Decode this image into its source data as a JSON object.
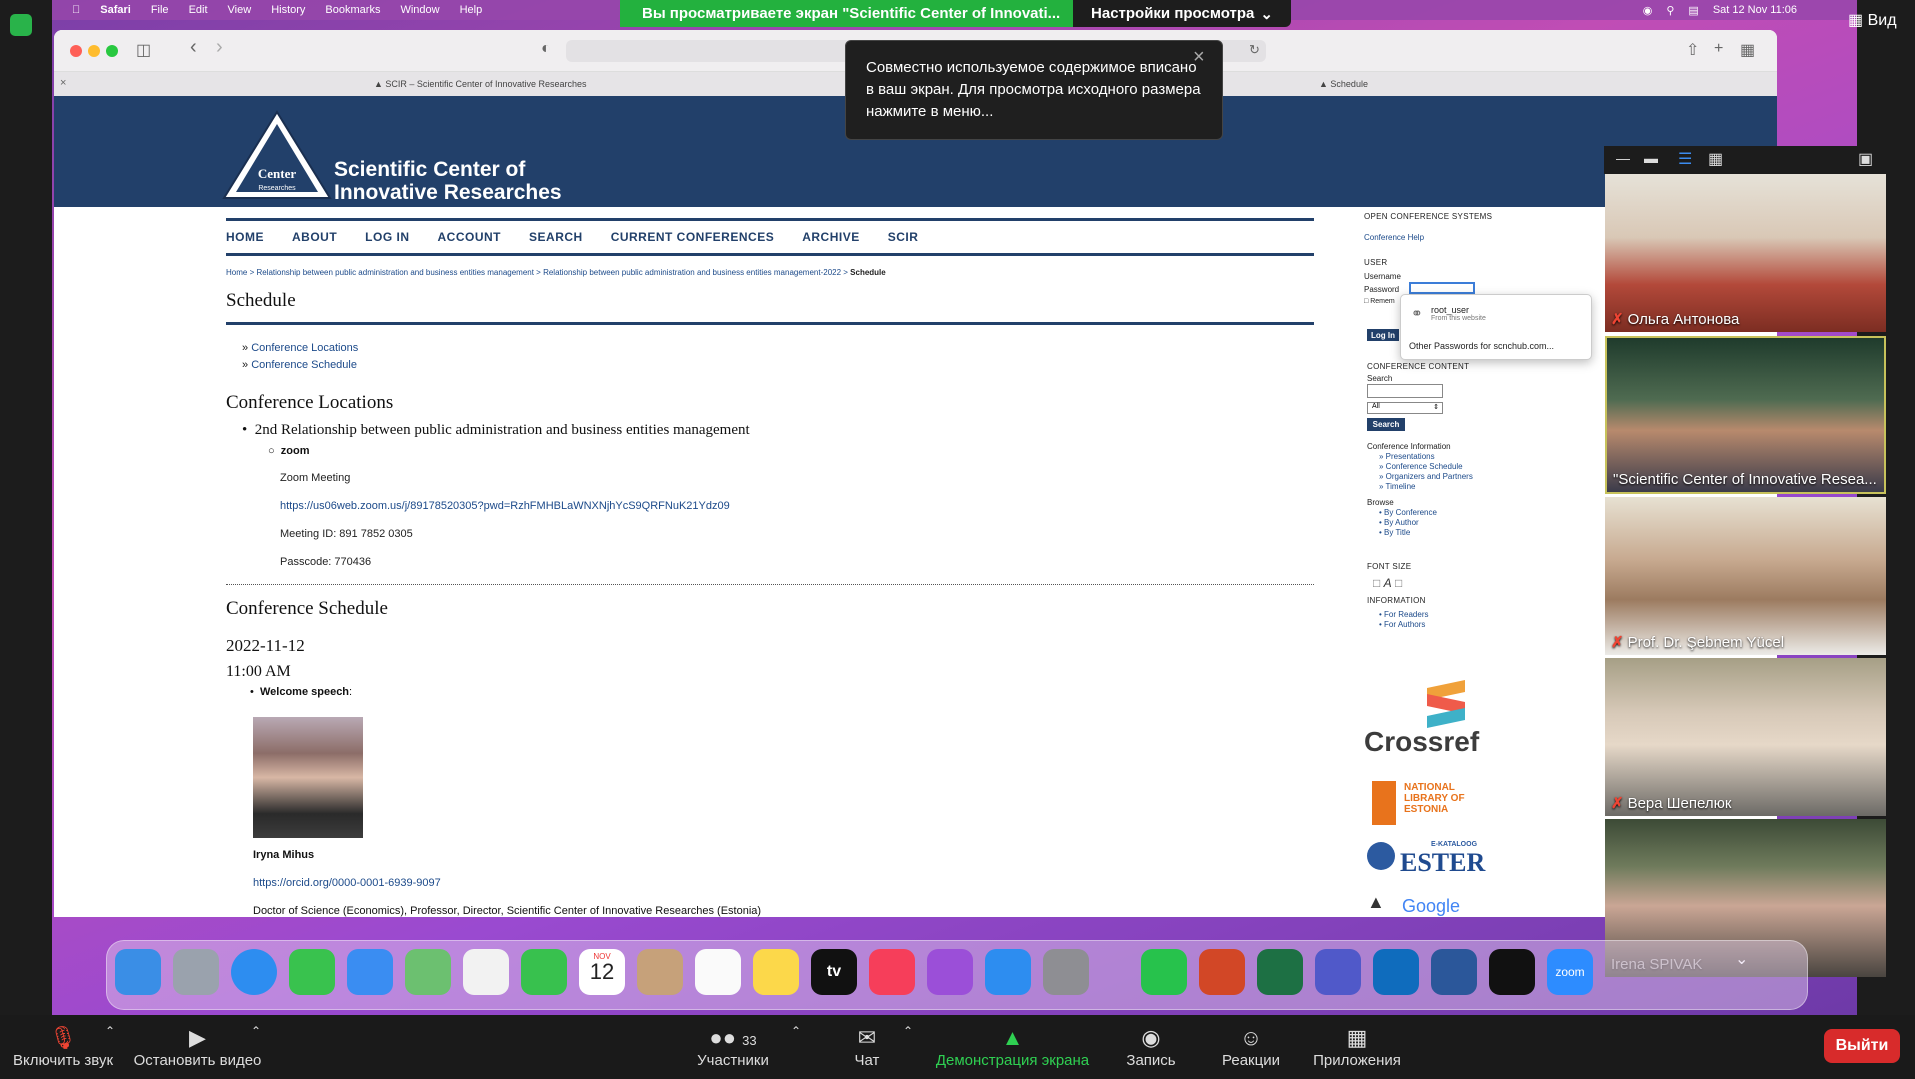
{
  "menubar": {
    "items": [
      "Safari",
      "File",
      "Edit",
      "View",
      "History",
      "Bookmarks",
      "Window",
      "Help"
    ],
    "datetime": "Sat 12 Nov  11:06"
  },
  "zoom_banner": {
    "sharing_text": "Вы просматриваете экран \"Scientific Center of Innovati...",
    "view_settings": "Настройки просмотра",
    "view_button": "Вид"
  },
  "safari": {
    "tab1": "SCIR – Scientific Center of Innovative Researches",
    "tab2": "Schedule"
  },
  "notification": {
    "text": "Совместно используемое содержимое вписано в ваш экран. Для просмотра исходного размера нажмите в меню..."
  },
  "site": {
    "logo_text": "Scientific Innovative Center Researches",
    "title_line1": "Scientific Center of",
    "title_line2": "Innovative Researches",
    "nav": [
      "HOME",
      "ABOUT",
      "LOG IN",
      "ACCOUNT",
      "SEARCH",
      "CURRENT CONFERENCES",
      "ARCHIVE",
      "SCIR"
    ],
    "breadcrumb": "Home > Relationship between public administration and business entities management > Relationship between public administration and business entities management-2022 > ",
    "breadcrumb_current": "Schedule",
    "heading": "Schedule",
    "toc": [
      "Conference Locations",
      "Conference Schedule"
    ],
    "loc_heading": "Conference Locations",
    "loc_item": "2nd Relationship between public administration and business entities management",
    "loc_sub": "zoom",
    "zoom_meeting": "Zoom Meeting",
    "zoom_link": "https://us06web.zoom.us/j/89178520305?pwd=RzhFMHBLaWNXNjhYcS9QRFNuK21Ydz09",
    "meeting_id": "Meeting ID: 891 7852 0305",
    "passcode": "Passcode: 770436",
    "sched_heading": "Conference Schedule",
    "date": "2022-11-12",
    "time": "11:00 AM",
    "welcome": "Welcome speech",
    "speaker": "Iryna Mihus",
    "orcid": "https://orcid.org/0000-0001-6939-9097",
    "bio": "Doctor of Science (Economics), Professor, Director, Scientific Center of Innovative Researches (Estonia)"
  },
  "sidebar": {
    "ocs": "OPEN CONFERENCE SYSTEMS",
    "help": "Conference Help",
    "user": "USER",
    "username": "Username",
    "password": "Password",
    "remember": "Remem",
    "login": "Log In",
    "content": "CONFERENCE CONTENT",
    "search_label": "Search",
    "search_option": "All",
    "search_btn": "Search",
    "conf_info": "Conference Information",
    "conf_links": [
      "Presentations",
      "Conference Schedule",
      "Organizers and Partners",
      "Timeline"
    ],
    "browse": "Browse",
    "browse_links": [
      "By Conference",
      "By Author",
      "By Title"
    ],
    "font_size": "FONT SIZE",
    "information": "INFORMATION",
    "info_links": [
      "For Readers",
      "For Authors"
    ],
    "pw_user": "root_user",
    "pw_from": "From this website",
    "pw_other": "Other Passwords for scnchub.com...",
    "crossref": "Crossref",
    "nle": "NATIONAL LIBRARY OF ESTONIA",
    "ester_small": "E-KATALOOG",
    "ester": "ESTER",
    "google": "Google"
  },
  "participants": [
    {
      "name": "Ольга Антонова",
      "muted": true
    },
    {
      "name": "\"Scientific Center of Innovative Resea...",
      "muted": false
    },
    {
      "name": "Prof. Dr. Şebnem Yücel",
      "muted": true
    },
    {
      "name": "Вера Шепелюк",
      "muted": true
    },
    {
      "name": "Irena SPIVAK",
      "muted": false
    }
  ],
  "dock": {
    "calendar_month": "NOV",
    "calendar_day": "12",
    "tv": "tv",
    "zoom": "zoom"
  },
  "zoom_bar": {
    "unmute": "Включить звук",
    "stop_video": "Остановить видео",
    "participants": "Участники",
    "participants_count": "33",
    "chat": "Чат",
    "share": "Демонстрация экрана",
    "record": "Запись",
    "reactions": "Реакции",
    "apps": "Приложения",
    "exit": "Выйти"
  },
  "colors": {
    "site_blue": "#22406a",
    "share_green": "#23b13e",
    "exit_red": "#d82b2b"
  }
}
